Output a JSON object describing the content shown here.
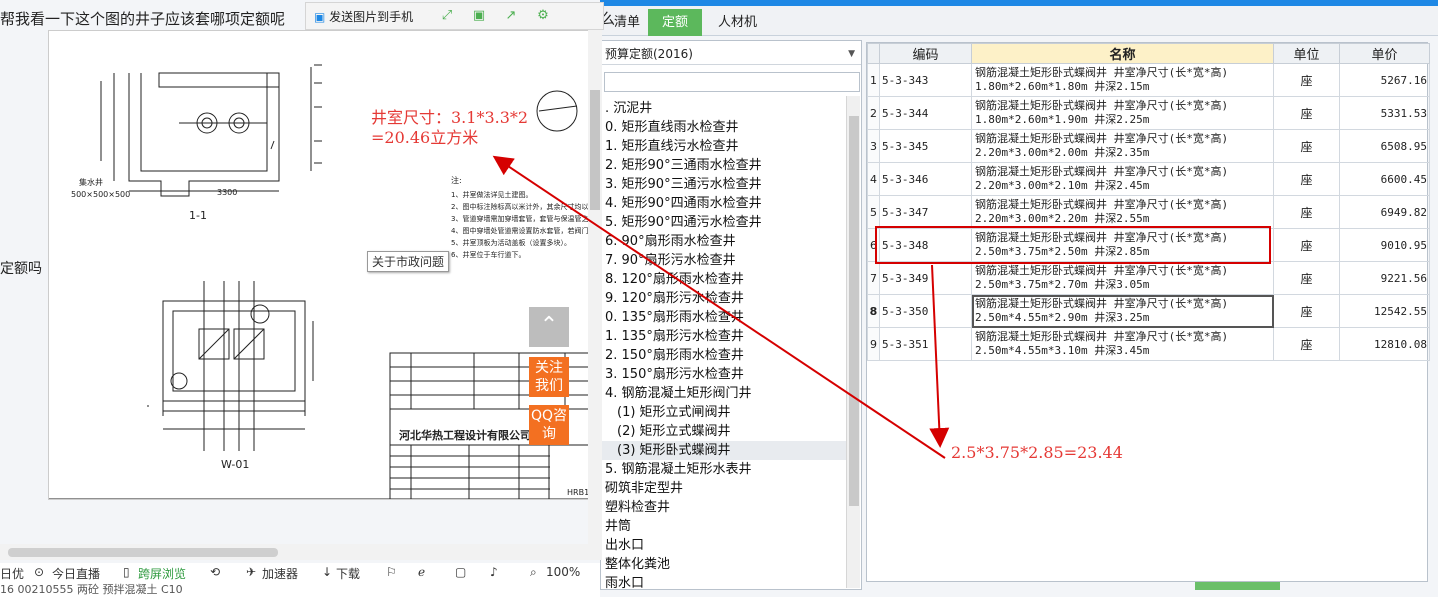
{
  "question": {
    "text": "帮我看一下这个图的井子应该套哪项定额呢",
    "tail": "怎么",
    "suffix": "定额吗"
  },
  "viewer": {
    "send_label": "发送图片到手机",
    "tooltip": "关于市政问题",
    "follow_label": "关注我们",
    "qq_label": "QQ咨询"
  },
  "annotations": {
    "well_line1": "井室尺寸：3.1*3.3*2",
    "well_line2": "=20.46立方米",
    "calc": "2.5*3.75*2.85=23.44"
  },
  "browser_status": {
    "items": [
      "日优",
      "今日直播",
      "跨屏浏览",
      "加速器",
      "下载",
      "100%"
    ]
  },
  "bottom_strip": "16  00210555     两砼   预拌混凝土                          C10",
  "app": {
    "tabs": [
      "清单",
      "定额",
      "人材机"
    ],
    "active_tab": "定额",
    "quota_select": "预算定额(2016)",
    "tree": [
      {
        "label": ". 沉泥井",
        "sub": false
      },
      {
        "label": "0. 矩形直线雨水检查井",
        "sub": false
      },
      {
        "label": "1. 矩形直线污水检查井",
        "sub": false
      },
      {
        "label": "2. 矩形90°三通雨水检查井",
        "sub": false
      },
      {
        "label": "3. 矩形90°三通污水检查井",
        "sub": false
      },
      {
        "label": "4. 矩形90°四通雨水检查井",
        "sub": false
      },
      {
        "label": "5. 矩形90°四通污水检查井",
        "sub": false
      },
      {
        "label": "6. 90°扇形雨水检查井",
        "sub": false
      },
      {
        "label": "7. 90°扇形污水检查井",
        "sub": false
      },
      {
        "label": "8. 120°扇形雨水检查井",
        "sub": false
      },
      {
        "label": "9. 120°扇形污水检查井",
        "sub": false
      },
      {
        "label": "0. 135°扇形雨水检查井",
        "sub": false
      },
      {
        "label": "1. 135°扇形污水检查井",
        "sub": false
      },
      {
        "label": "2. 150°扇形雨水检查井",
        "sub": false
      },
      {
        "label": "3. 150°扇形污水检查井",
        "sub": false
      },
      {
        "label": "4. 钢筋混凝土矩形阀门井",
        "sub": false
      },
      {
        "label": "(1) 矩形立式闸阀井",
        "sub": true
      },
      {
        "label": "(2) 矩形立式蝶阀井",
        "sub": true
      },
      {
        "label": "(3) 矩形卧式蝶阀井",
        "sub": true
      },
      {
        "label": "5. 钢筋混凝土矩形水表井",
        "sub": false
      },
      {
        "label": "砌筑非定型井",
        "sub": false
      },
      {
        "label": "塑料检查井",
        "sub": false
      },
      {
        "label": "井筒",
        "sub": false
      },
      {
        "label": "出水口",
        "sub": false
      },
      {
        "label": "整体化粪池",
        "sub": false
      },
      {
        "label": "雨水口",
        "sub": false
      }
    ],
    "selected_tree_index": 18,
    "grid": {
      "headers": [
        "编码",
        "名称",
        "单位",
        "单价"
      ],
      "rows": [
        {
          "idx": "1",
          "code": "5-3-343",
          "name1": "钢筋混凝土矩形卧式蝶阀井 井室净尺寸(长*宽*高)",
          "name2": "1.80m*2.60m*1.80m 井深2.15m",
          "unit": "座",
          "price": "5267.16"
        },
        {
          "idx": "2",
          "code": "5-3-344",
          "name1": "钢筋混凝土矩形卧式蝶阀井 井室净尺寸(长*宽*高)",
          "name2": "1.80m*2.60m*1.90m 井深2.25m",
          "unit": "座",
          "price": "5331.53"
        },
        {
          "idx": "3",
          "code": "5-3-345",
          "name1": "钢筋混凝土矩形卧式蝶阀井 井室净尺寸(长*宽*高)",
          "name2": "2.20m*3.00m*2.00m 井深2.35m",
          "unit": "座",
          "price": "6508.95"
        },
        {
          "idx": "4",
          "code": "5-3-346",
          "name1": "钢筋混凝土矩形卧式蝶阀井 井室净尺寸(长*宽*高)",
          "name2": "2.20m*3.00m*2.10m 井深2.45m",
          "unit": "座",
          "price": "6600.45"
        },
        {
          "idx": "5",
          "code": "5-3-347",
          "name1": "钢筋混凝土矩形卧式蝶阀井 井室净尺寸(长*宽*高)",
          "name2": "2.20m*3.00m*2.20m 井深2.55m",
          "unit": "座",
          "price": "6949.82"
        },
        {
          "idx": "6",
          "code": "5-3-348",
          "name1": "钢筋混凝土矩形卧式蝶阀井 井室净尺寸(长*宽*高)",
          "name2": "2.50m*3.75m*2.50m 井深2.85m",
          "unit": "座",
          "price": "9010.95"
        },
        {
          "idx": "7",
          "code": "5-3-349",
          "name1": "钢筋混凝土矩形卧式蝶阀井 井室净尺寸(长*宽*高)",
          "name2": "2.50m*3.75m*2.70m 井深3.05m",
          "unit": "座",
          "price": "9221.56"
        },
        {
          "idx": "8",
          "code": "5-3-350",
          "name1": "钢筋混凝土矩形卧式蝶阀井 井室净尺寸(长*宽*高)",
          "name2": "2.50m*4.55m*2.90m 井深3.25m",
          "unit": "座",
          "price": "12542.55"
        },
        {
          "idx": "9",
          "code": "5-3-351",
          "name1": "钢筋混凝土矩形卧式蝶阀井 井室净尺寸(长*宽*高)",
          "name2": "2.50m*4.55m*3.10m 井深3.45m",
          "unit": "座",
          "price": "12810.08"
        }
      ],
      "current_row": "8"
    }
  },
  "drawing": {
    "title_section": "1-1",
    "title_plan": "W-01",
    "company": "河北华热工程设计有限公司",
    "drawing_no": "HRB17",
    "pit_label": "集水井",
    "pit_size": "500×500×500",
    "width_label": "3300",
    "notes_title": "注:",
    "notes": [
      "1、井室做法详见土建图。",
      "2、图中标注除标高以米计外，其余尺寸均以毫",
      "3、管道穿墙需加穿墙套管，套管与保温管之间",
      "4、图中穿墙处管道需设置防水套管，若阀门",
      "5、井室顶板为活动盖板（设置多块）。",
      "6、井室位于车行道下。"
    ]
  },
  "colors": {
    "accent_green": "#5cb85c",
    "annotation_red": "#e53935",
    "orange": "#f37021"
  }
}
